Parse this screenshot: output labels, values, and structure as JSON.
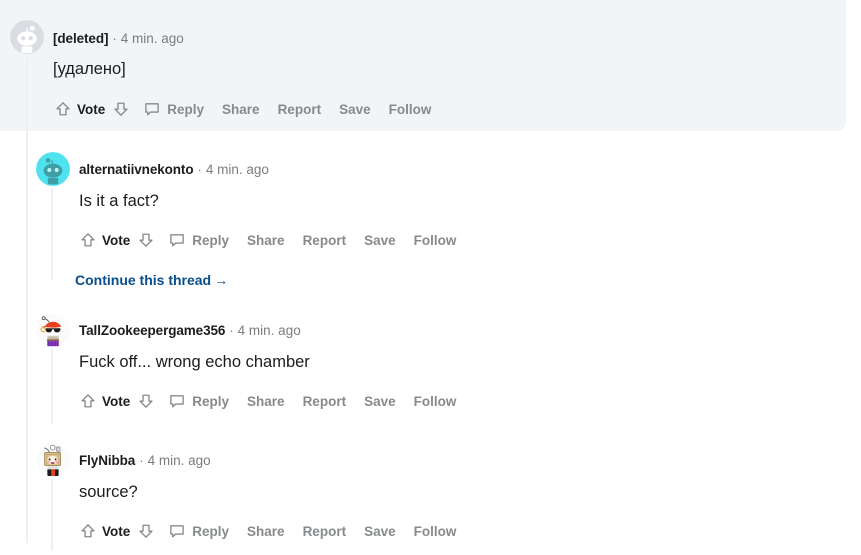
{
  "page": {
    "background_color": "#ffffff",
    "highlight_color": "#f2f5f8",
    "link_color": "#0a4d8c",
    "muted_text_color": "#878a8c",
    "body_text_color": "#1c1c1c"
  },
  "action_bar": {
    "upvote_icon": "upvote-arrow-icon",
    "vote_label": "Vote",
    "downvote_icon": "downvote-arrow-icon",
    "comment_icon": "comment-bubble-icon",
    "reply_label": "Reply",
    "share_label": "Share",
    "report_label": "Report",
    "save_label": "Save",
    "follow_label": "Follow"
  },
  "comments": [
    {
      "id": "comment-deleted",
      "author": "[deleted]",
      "separator": "·",
      "timestamp": "4 min. ago",
      "body": "[удалено]",
      "avatar": "deleted-user-snoo-avatar",
      "highlighted": true,
      "depth": 0
    },
    {
      "id": "comment-alternatiivnekonto",
      "author": "alternatiivnekonto",
      "separator": "·",
      "timestamp": "4 min. ago",
      "body": "Is it a fact?",
      "avatar": "cyan-snoo-avatar",
      "highlighted": false,
      "depth": 1
    },
    {
      "id": "comment-tallzookeepergame356",
      "author": "TallZookeepergame356",
      "separator": "·",
      "timestamp": "4 min. ago",
      "body": "Fuck off... wrong echo chamber",
      "avatar": "pirate-snoo-avatar",
      "highlighted": false,
      "depth": 1
    },
    {
      "id": "comment-flynibba",
      "author": "FlyNibba",
      "separator": "·",
      "timestamp": "4 min. ago",
      "body": "source?",
      "avatar": "boxhead-snoo-avatar",
      "highlighted": false,
      "depth": 1
    }
  ],
  "continue_thread": {
    "label": "Continue this thread",
    "arrow": "→"
  }
}
